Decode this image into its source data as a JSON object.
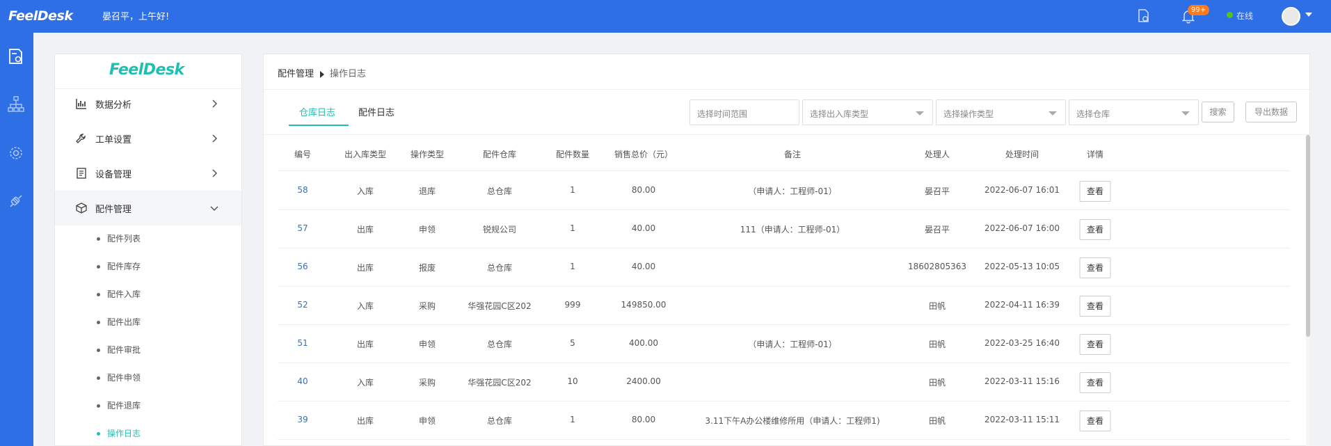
{
  "header": {
    "logo": "FeelDesk",
    "greeting": "晏召平，上午好!",
    "notification_badge": "99+",
    "status": "在线"
  },
  "side_menu": {
    "logo": "FeelDesk",
    "items": [
      {
        "label": "数据分析",
        "icon": "bar-chart-icon"
      },
      {
        "label": "工单设置",
        "icon": "wrench-icon"
      },
      {
        "label": "设备管理",
        "icon": "device-icon"
      },
      {
        "label": "配件管理",
        "icon": "box-icon"
      }
    ],
    "sub_items": [
      "配件列表",
      "配件库存",
      "配件入库",
      "配件出库",
      "配件审批",
      "配件申领",
      "配件退库",
      "操作日志"
    ],
    "active_sub": "操作日志"
  },
  "breadcrumb": {
    "parent": "配件管理",
    "current": "操作日志"
  },
  "tabs": [
    {
      "label": "仓库日志",
      "active": true
    },
    {
      "label": "配件日志",
      "active": false
    }
  ],
  "filters": {
    "date_range": "选择时间范围",
    "io_type": "选择出入库类型",
    "op_type": "选择操作类型",
    "warehouse": "选择仓库",
    "search": "搜索",
    "export": "导出数据"
  },
  "table": {
    "columns": [
      "编号",
      "出入库类型",
      "操作类型",
      "配件仓库",
      "配件数量",
      "销售总价（元）",
      "备注",
      "处理人",
      "处理时间",
      "详情"
    ],
    "rows": [
      {
        "id": "58",
        "io": "入库",
        "op": "退库",
        "warehouse": "总仓库",
        "qty": "1",
        "total": "80.00",
        "note": "（申请人：工程师-01）",
        "handler": "晏召平",
        "time": "2022-06-07 16:01",
        "action": "查看"
      },
      {
        "id": "57",
        "io": "出库",
        "op": "申领",
        "warehouse": "锐规公司",
        "qty": "1",
        "total": "40.00",
        "note": "111（申请人：工程师-01）",
        "handler": "晏召平",
        "time": "2022-06-07 16:00",
        "action": "查看"
      },
      {
        "id": "56",
        "io": "出库",
        "op": "报废",
        "warehouse": "总仓库",
        "qty": "1",
        "total": "40.00",
        "note": "",
        "handler": "18602805363",
        "time": "2022-05-13 10:05",
        "action": "查看"
      },
      {
        "id": "52",
        "io": "入库",
        "op": "采购",
        "warehouse": "华强花园C区202",
        "qty": "999",
        "total": "149850.00",
        "note": "",
        "handler": "田帆",
        "time": "2022-04-11 16:39",
        "action": "查看"
      },
      {
        "id": "51",
        "io": "出库",
        "op": "申领",
        "warehouse": "总仓库",
        "qty": "5",
        "total": "400.00",
        "note": "（申请人：工程师-01）",
        "handler": "田帆",
        "time": "2022-03-25 16:40",
        "action": "查看"
      },
      {
        "id": "40",
        "io": "入库",
        "op": "采购",
        "warehouse": "华强花园C区202",
        "qty": "10",
        "total": "2400.00",
        "note": "",
        "handler": "田帆",
        "time": "2022-03-11 15:16",
        "action": "查看"
      },
      {
        "id": "39",
        "io": "出库",
        "op": "申领",
        "warehouse": "总仓库",
        "qty": "1",
        "total": "80.00",
        "note": "3.11下午A办公楼维修所用（申请人：工程师1)",
        "handler": "田帆",
        "time": "2022-03-11 15:11",
        "action": "查看"
      }
    ]
  },
  "colors": {
    "primary": "#2f6fe6",
    "accent": "#1fc0b4",
    "badge": "#ff7a1a"
  }
}
